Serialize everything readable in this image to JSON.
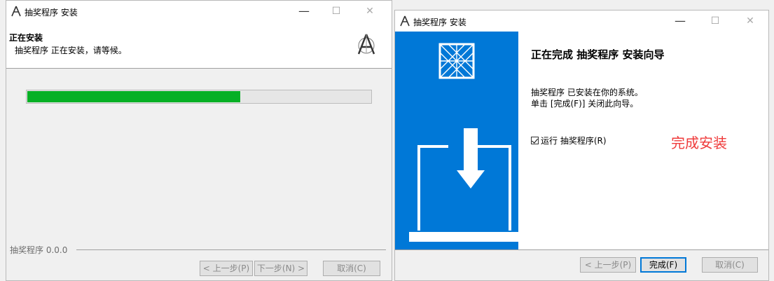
{
  "left_window": {
    "title": "抽奖程序 安装",
    "header_title": "正在安装",
    "header_subtitle": "抽奖程序 正在安装，请等候。",
    "progress": 0.62,
    "brand_text": "抽奖程序 0.0.0",
    "back_label": "< 上一步(P)",
    "next_label": "下一步(N) >",
    "cancel_label": "取消(C)",
    "minimize": "—",
    "maximize": "☐",
    "close": "✕",
    "colors": {
      "progress_fill": "#06b025"
    }
  },
  "right_window": {
    "title": "抽奖程序 安装",
    "heading": "正在完成 抽奖程序 安装向导",
    "line1": "抽奖程序 已安装在你的系统。",
    "line2": "单击 [完成(F)] 关闭此向导。",
    "checkbox_label": "运行 抽奖程序(R)",
    "checkbox_checked": true,
    "annotation": "完成安装",
    "back_label": "< 上一步(P)",
    "finish_label": "完成(F)",
    "cancel_label": "取消(C)",
    "minimize": "—",
    "maximize": "☐",
    "close": "✕",
    "colors": {
      "sidebar": "#0078d7",
      "annotation": "#ef3b3b"
    }
  }
}
